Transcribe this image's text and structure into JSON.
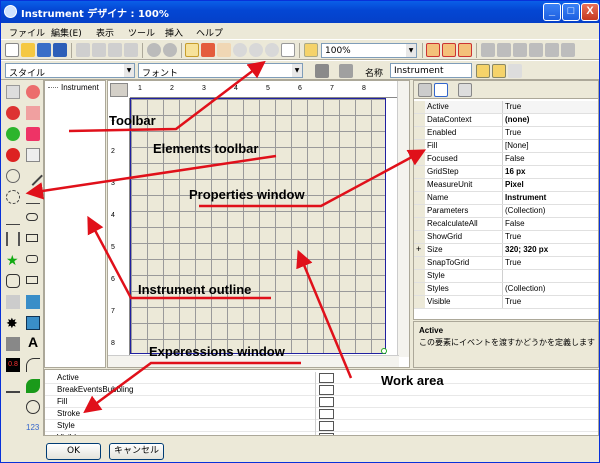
{
  "window": {
    "title": "Instrument デザイナ : 100%",
    "min": "_",
    "max": "□",
    "close": "X"
  },
  "menu": [
    "ファイル",
    "編集(E)",
    "表示",
    "ツール",
    "挿入",
    "ヘルプ"
  ],
  "toolbar": {
    "zoom": "100%"
  },
  "toolbar2": {
    "style_label": "スタイル",
    "font_label": "フォント",
    "name_label": "名称",
    "name_value": "Instrument"
  },
  "outline": {
    "root": "Instrument"
  },
  "ruler": {
    "h": [
      "1",
      "2",
      "3",
      "4",
      "5",
      "6",
      "7",
      "8"
    ],
    "v": [
      "1",
      "2",
      "3",
      "4",
      "5",
      "6",
      "7",
      "8"
    ]
  },
  "properties": [
    {
      "k": "Active",
      "v": "True",
      "b": false
    },
    {
      "k": "DataContext",
      "v": "(none)",
      "b": true
    },
    {
      "k": "Enabled",
      "v": "True",
      "b": false
    },
    {
      "k": "Fill",
      "v": "[None]",
      "b": false
    },
    {
      "k": "Focused",
      "v": "False",
      "b": false
    },
    {
      "k": "GridStep",
      "v": "16 px",
      "b": true
    },
    {
      "k": "MeasureUnit",
      "v": "Pixel",
      "b": true
    },
    {
      "k": "Name",
      "v": "Instrument",
      "b": true
    },
    {
      "k": "Parameters",
      "v": "(Collection)",
      "b": false
    },
    {
      "k": "RecalculateAll",
      "v": "False",
      "b": false
    },
    {
      "k": "ShowGrid",
      "v": "True",
      "b": false
    },
    {
      "k": "Size",
      "v": "320; 320 px",
      "b": true,
      "expand": "+"
    },
    {
      "k": "SnapToGrid",
      "v": "True",
      "b": false
    },
    {
      "k": "Style",
      "v": "",
      "b": false
    },
    {
      "k": "Styles",
      "v": "(Collection)",
      "b": false
    },
    {
      "k": "Visible",
      "v": "True",
      "b": false
    }
  ],
  "propdesc": {
    "title": "Active",
    "text": "この要素にイベントを渡すかどうかを定義します"
  },
  "expressions": [
    "Active",
    "BreakEventsBubbling",
    "Fill",
    "Stroke",
    "Style",
    "Visible"
  ],
  "buttons": {
    "ok": "OK",
    "cancel": "キャンセル"
  },
  "annotations": {
    "toolbar": "Toolbar",
    "elements_toolbar": "Elements toolbar",
    "properties_window": "Properties window",
    "instrument_outline": "Instrument outline",
    "expressions_window": "Experessions window",
    "work_area": "Work area"
  },
  "colors": {
    "titlebar": "#0447d4",
    "annotation_arrow": "#e0101a",
    "grid_bg": "#ece9d8"
  }
}
